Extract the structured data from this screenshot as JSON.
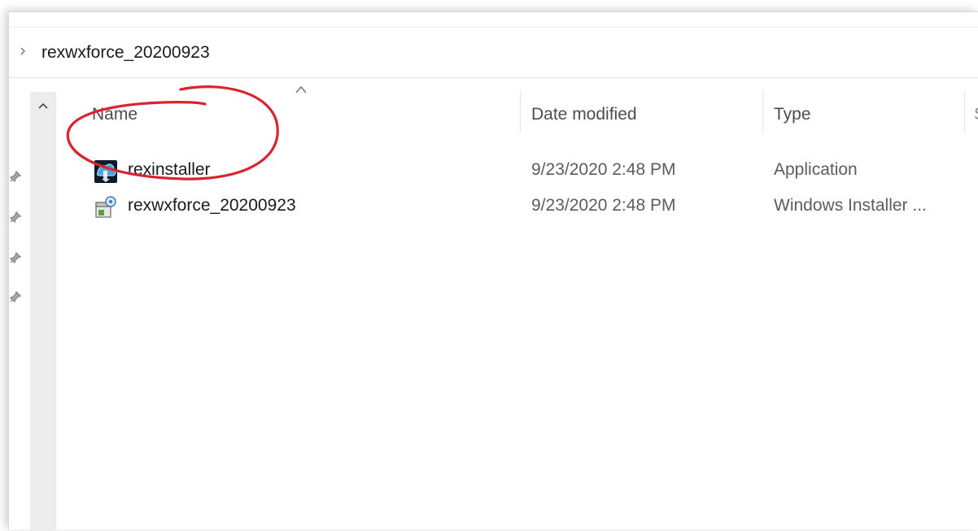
{
  "address_bar": {
    "chevron_icon": "chevron-right-icon",
    "folder_name": "rexwxforce_20200923"
  },
  "columns": {
    "sort_icon": "chevron-up-icon",
    "name": "Name",
    "date_modified": "Date modified",
    "type": "Type",
    "size_partial": "S"
  },
  "files": [
    {
      "name": "rexinstaller",
      "date_modified": "9/23/2020 2:48 PM",
      "type": "Application",
      "icon": "application-icon"
    },
    {
      "name": "rexwxforce_20200923",
      "date_modified": "9/23/2020 2:48 PM",
      "type": "Windows Installer ...",
      "icon": "installer-package-icon"
    }
  ],
  "nav_pane": {
    "pin_icons": [
      "pin-icon",
      "pin-icon",
      "pin-icon",
      "pin-icon"
    ]
  },
  "annotation": {
    "color": "#d9232e",
    "circled_item": "rexinstaller"
  }
}
